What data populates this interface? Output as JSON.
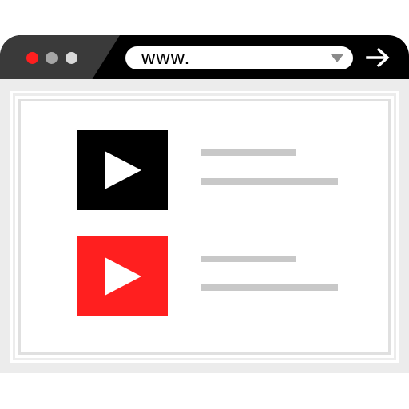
{
  "address_bar": {
    "url": "www.",
    "icons": {
      "dropdown": "chevron-down-icon",
      "go": "arrow-right-icon"
    }
  },
  "window_controls": [
    {
      "name": "close",
      "color": "#ff1f1f"
    },
    {
      "name": "minimize",
      "color": "#a6a6a6"
    },
    {
      "name": "maximize",
      "color": "#d9d9d9"
    }
  ],
  "videos": [
    {
      "thumbnail_color": "#000000",
      "icon": "play-icon"
    },
    {
      "thumbnail_color": "#ff1f1f",
      "icon": "play-icon"
    }
  ],
  "colors": {
    "titlebar": "#000000",
    "titlebar_accent": "#3a3a3a",
    "content_background": "#ececec",
    "placeholder_line": "#c8c8c8"
  }
}
